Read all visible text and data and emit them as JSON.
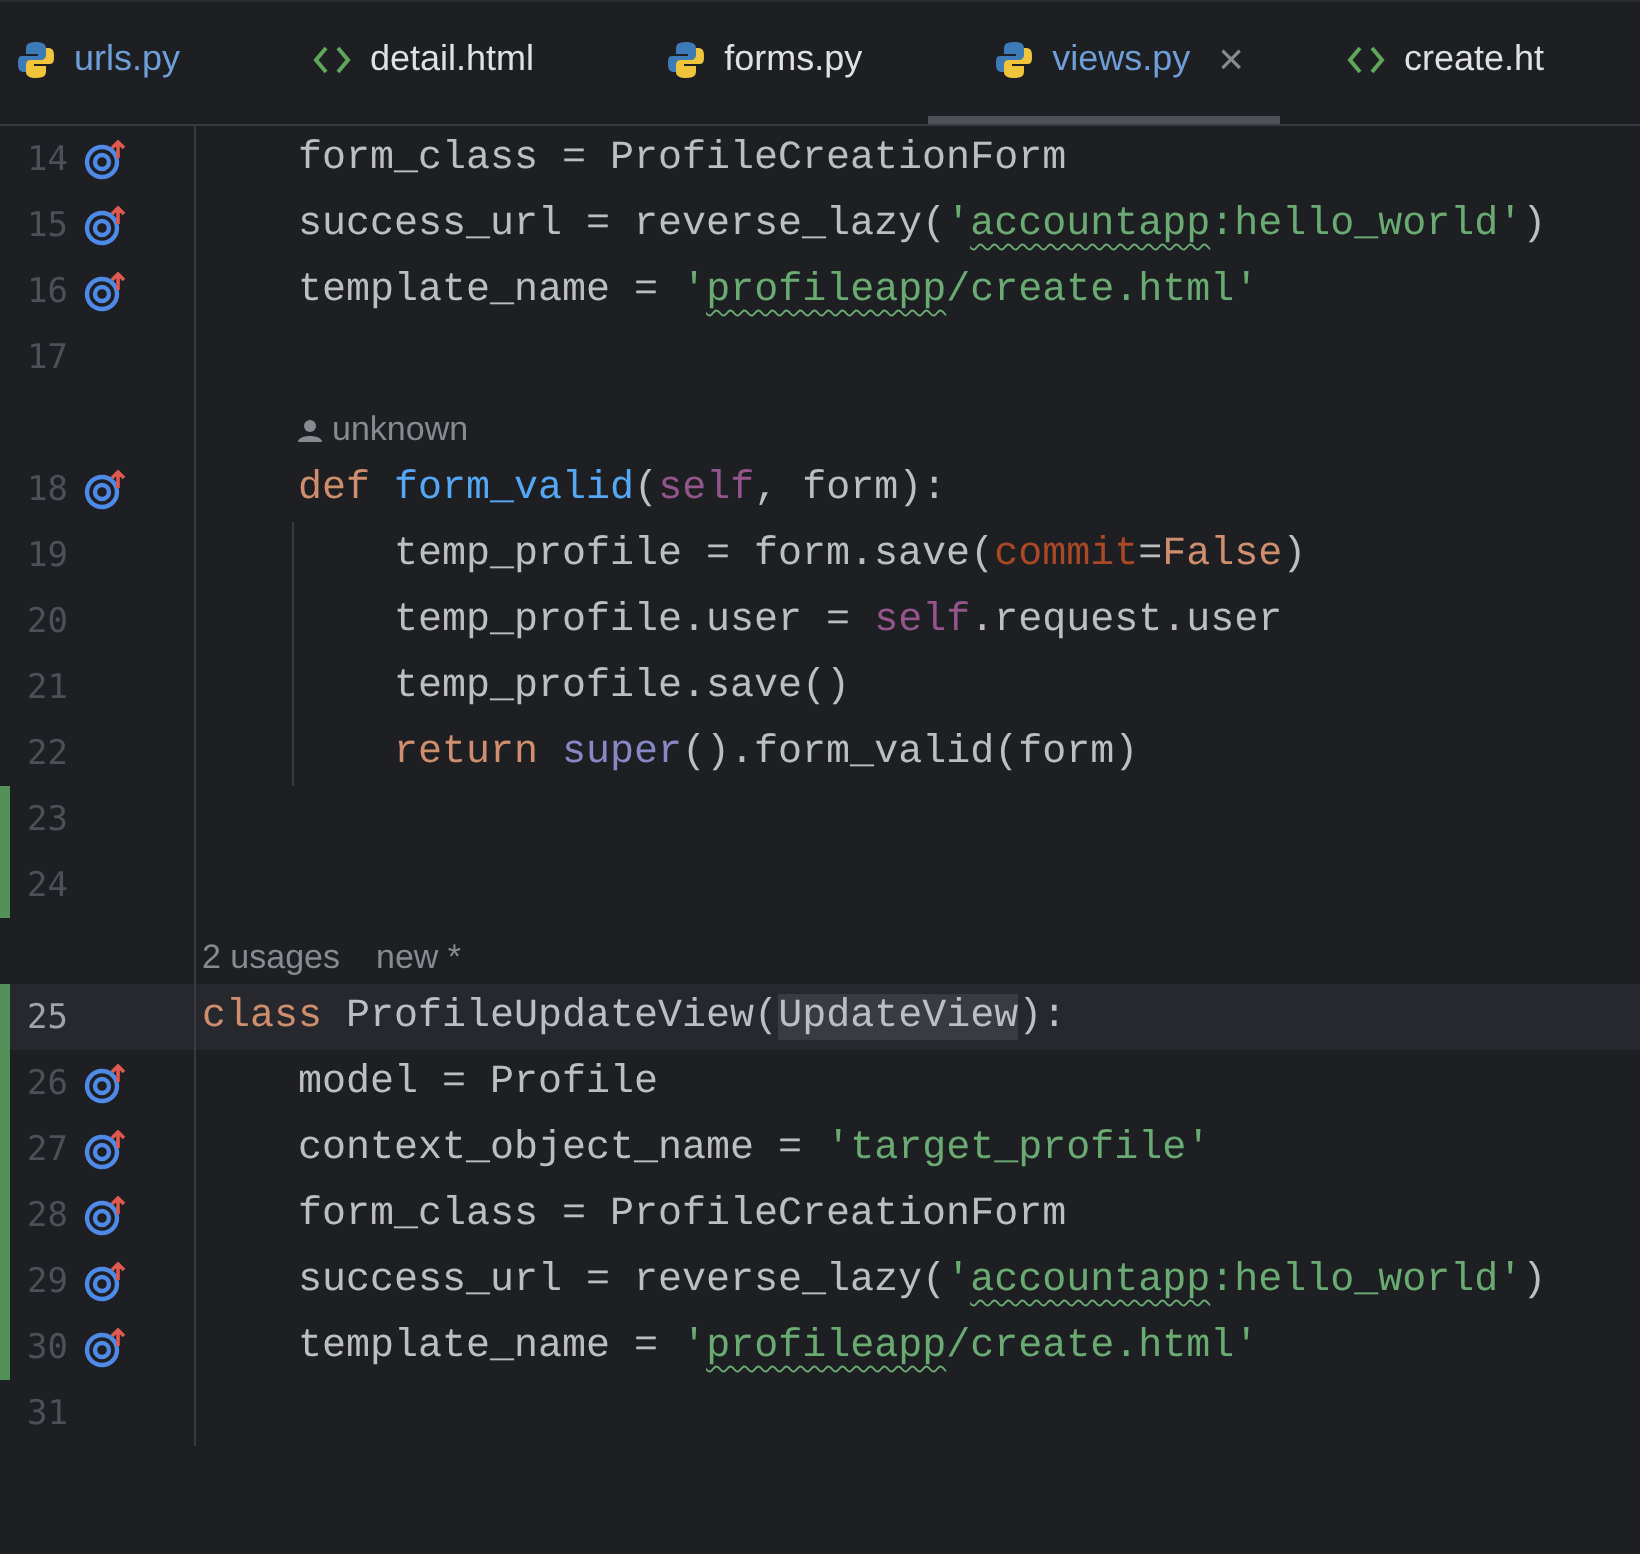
{
  "tabs": [
    {
      "kind": "python",
      "label": "urls.py",
      "modified": true,
      "selected": false
    },
    {
      "kind": "html",
      "label": "detail.html",
      "modified": false,
      "selected": false
    },
    {
      "kind": "python",
      "label": "forms.py",
      "modified": false,
      "selected": false
    },
    {
      "kind": "python",
      "label": "views.py",
      "modified": true,
      "selected": true,
      "close": "×"
    },
    {
      "kind": "html",
      "label": "create.ht",
      "modified": false,
      "selected": false
    }
  ],
  "lines": [
    {
      "kind": "code",
      "number": "14",
      "marker": true,
      "changed": false,
      "current": false,
      "guide": false,
      "tokens": [
        {
          "kind": "plain",
          "text": "    form_class = ProfileCreationForm"
        }
      ]
    },
    {
      "kind": "code",
      "number": "15",
      "marker": true,
      "changed": false,
      "current": false,
      "guide": false,
      "tokens": [
        {
          "kind": "plain",
          "text": "    success_url = reverse_lazy("
        },
        {
          "kind": "string",
          "text": "'"
        },
        {
          "kind": "string",
          "text": "accountapp",
          "typo": true
        },
        {
          "kind": "string",
          "text": ":hello_world'"
        },
        {
          "kind": "plain",
          "text": ")"
        }
      ]
    },
    {
      "kind": "code",
      "number": "16",
      "marker": true,
      "changed": false,
      "current": false,
      "guide": false,
      "tokens": [
        {
          "kind": "plain",
          "text": "    template_name = "
        },
        {
          "kind": "string",
          "text": "'"
        },
        {
          "kind": "string",
          "text": "profileapp",
          "typo": true
        },
        {
          "kind": "string",
          "text": "/create.html'"
        }
      ]
    },
    {
      "kind": "code",
      "number": "17",
      "marker": false,
      "changed": false,
      "current": false,
      "guide": false
    },
    {
      "kind": "hint",
      "parts": [
        {
          "kind": "author",
          "text": "unknown"
        }
      ]
    },
    {
      "kind": "code",
      "number": "18",
      "marker": true,
      "changed": false,
      "current": false,
      "guide": false,
      "tokens": [
        {
          "kind": "keyword",
          "text": "    def "
        },
        {
          "kind": "func",
          "text": "form_valid"
        },
        {
          "kind": "plain",
          "text": "("
        },
        {
          "kind": "self",
          "text": "self"
        },
        {
          "kind": "plain",
          "text": ", form):"
        }
      ]
    },
    {
      "kind": "code",
      "number": "19",
      "marker": false,
      "changed": false,
      "current": false,
      "guide": true,
      "tokens": [
        {
          "kind": "plain",
          "text": "        temp_profile = form.save("
        },
        {
          "kind": "param",
          "text": "commit"
        },
        {
          "kind": "plain",
          "text": "="
        },
        {
          "kind": "keyword",
          "text": "False"
        },
        {
          "kind": "plain",
          "text": ")"
        }
      ]
    },
    {
      "kind": "code",
      "number": "20",
      "marker": false,
      "changed": false,
      "current": false,
      "guide": true,
      "tokens": [
        {
          "kind": "plain",
          "text": "        temp_profile.user = "
        },
        {
          "kind": "self",
          "text": "self"
        },
        {
          "kind": "plain",
          "text": ".request.user"
        }
      ]
    },
    {
      "kind": "code",
      "number": "21",
      "marker": false,
      "changed": false,
      "current": false,
      "guide": true,
      "tokens": [
        {
          "kind": "plain",
          "text": "        temp_profile.save()"
        }
      ]
    },
    {
      "kind": "code",
      "number": "22",
      "marker": false,
      "changed": false,
      "current": false,
      "guide": true,
      "tokens": [
        {
          "kind": "keyword",
          "text": "        return "
        },
        {
          "kind": "builtin",
          "text": "super"
        },
        {
          "kind": "plain",
          "text": "().form_valid(form)"
        }
      ]
    },
    {
      "kind": "code",
      "number": "23",
      "marker": false,
      "changed": true,
      "current": false,
      "guide": false
    },
    {
      "kind": "code",
      "number": "24",
      "marker": false,
      "changed": true,
      "current": false,
      "guide": false
    },
    {
      "kind": "hint",
      "parts": [
        {
          "kind": "plain",
          "text": "2 usages"
        },
        {
          "kind": "plain",
          "text": "new *"
        }
      ]
    },
    {
      "kind": "code",
      "number": "25",
      "marker": false,
      "changed": true,
      "current": true,
      "guide": false,
      "tokens": [
        {
          "kind": "keyword",
          "text": "class "
        },
        {
          "kind": "plain",
          "text": "ProfileUpdateView("
        },
        {
          "kind": "plain",
          "text": "UpdateView",
          "highlight": true
        },
        {
          "kind": "plain",
          "text": "):"
        }
      ]
    },
    {
      "kind": "code",
      "number": "26",
      "marker": true,
      "changed": true,
      "current": false,
      "guide": false,
      "tokens": [
        {
          "kind": "plain",
          "text": "    model = Profile"
        }
      ]
    },
    {
      "kind": "code",
      "number": "27",
      "marker": true,
      "changed": true,
      "current": false,
      "guide": false,
      "tokens": [
        {
          "kind": "plain",
          "text": "    context_object_name = "
        },
        {
          "kind": "string",
          "text": "'target_profile'"
        }
      ]
    },
    {
      "kind": "code",
      "number": "28",
      "marker": true,
      "changed": true,
      "current": false,
      "guide": false,
      "tokens": [
        {
          "kind": "plain",
          "text": "    form_class = ProfileCreationForm"
        }
      ]
    },
    {
      "kind": "code",
      "number": "29",
      "marker": true,
      "changed": true,
      "current": false,
      "guide": false,
      "tokens": [
        {
          "kind": "plain",
          "text": "    success_url = reverse_lazy("
        },
        {
          "kind": "string",
          "text": "'"
        },
        {
          "kind": "string",
          "text": "accountapp",
          "typo": true
        },
        {
          "kind": "string",
          "text": ":hello_world'"
        },
        {
          "kind": "plain",
          "text": ")"
        }
      ]
    },
    {
      "kind": "code",
      "number": "30",
      "marker": true,
      "changed": true,
      "current": false,
      "guide": false,
      "tokens": [
        {
          "kind": "plain",
          "text": "    template_name = "
        },
        {
          "kind": "string",
          "text": "'"
        },
        {
          "kind": "string",
          "text": "profileapp",
          "typo": true
        },
        {
          "kind": "string",
          "text": "/create.html'"
        }
      ]
    },
    {
      "kind": "code",
      "number": "31",
      "marker": false,
      "changed": false,
      "current": false,
      "guide": false
    }
  ]
}
